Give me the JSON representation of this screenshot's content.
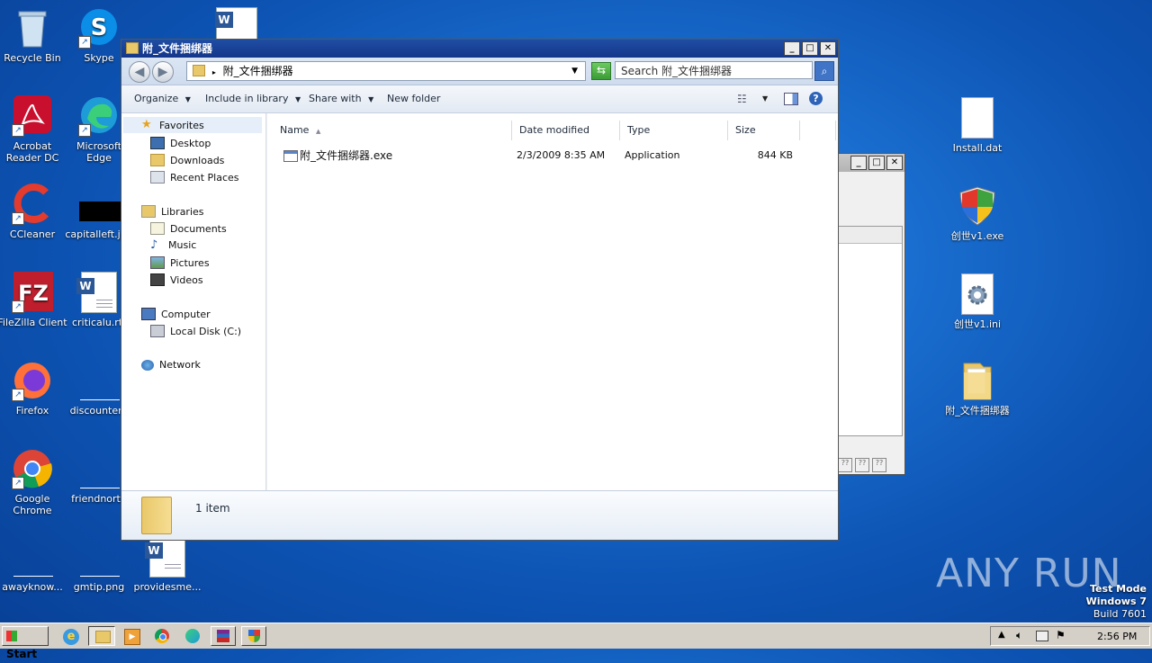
{
  "desktop_left": [
    {
      "label": "Recycle Bin",
      "icon": "recycle-bin-icon"
    },
    {
      "label": "Skype",
      "icon": "skype-icon"
    },
    {
      "label": "Acrobat Reader DC",
      "icon": "acrobat-icon"
    },
    {
      "label": "Microsoft Edge",
      "icon": "edge-icon"
    },
    {
      "label": "CCleaner",
      "icon": "ccleaner-icon"
    },
    {
      "label": "capitalleft.jpg",
      "icon": "image-file-icon"
    },
    {
      "label": "FileZilla Client",
      "icon": "filezilla-icon"
    },
    {
      "label": "criticalu.rtf",
      "icon": "word-doc-icon"
    },
    {
      "label": "Firefox",
      "icon": "firefox-icon"
    },
    {
      "label": "discountent",
      "icon": "blank-file-icon"
    },
    {
      "label": "Google Chrome",
      "icon": "chrome-icon"
    },
    {
      "label": "friendnorth",
      "icon": "blank-file-icon"
    },
    {
      "label": "awayknow...",
      "icon": "blank-file-icon"
    },
    {
      "label": "gmtip.png",
      "icon": "blank-file-icon"
    },
    {
      "label": "providesme...",
      "icon": "word-doc-icon"
    }
  ],
  "desktop_right": [
    {
      "label": "Install.dat",
      "icon": "blank-file-icon"
    },
    {
      "label": "创世v1.exe",
      "icon": "shield-exe-icon"
    },
    {
      "label": "创世v1.ini",
      "icon": "ini-file-icon"
    },
    {
      "label": "附_文件捆绑器",
      "icon": "folder-icon"
    }
  ],
  "explorer": {
    "title": "附_文件捆绑器",
    "address": "附_文件捆绑器",
    "search_placeholder": "Search 附_文件捆绑器",
    "toolbar": {
      "organize": "Organize",
      "include_in_library": "Include in library",
      "share_with": "Share with",
      "new_folder": "New folder"
    },
    "nav": {
      "favorites": "Favorites",
      "desktop": "Desktop",
      "downloads": "Downloads",
      "recent_places": "Recent Places",
      "libraries": "Libraries",
      "documents": "Documents",
      "music": "Music",
      "pictures": "Pictures",
      "videos": "Videos",
      "computer": "Computer",
      "local_disk": "Local Disk (C:)",
      "network": "Network"
    },
    "columns": {
      "name": "Name",
      "date": "Date modified",
      "type": "Type",
      "size": "Size"
    },
    "files": [
      {
        "name": "附_文件捆绑器.exe",
        "date": "2/3/2009 8:35 AM",
        "type": "Application",
        "size": "844 KB"
      }
    ],
    "status": "1 item"
  },
  "watermark": {
    "brand": "ANY RUN",
    "line1": "Test Mode",
    "line2": "Windows 7",
    "line3": "Build 7601"
  },
  "taskbar": {
    "start": "Start",
    "time": "2:56 PM"
  },
  "colors": {
    "accent": "#1f4ea3",
    "desktop": "#1a6fd0"
  }
}
